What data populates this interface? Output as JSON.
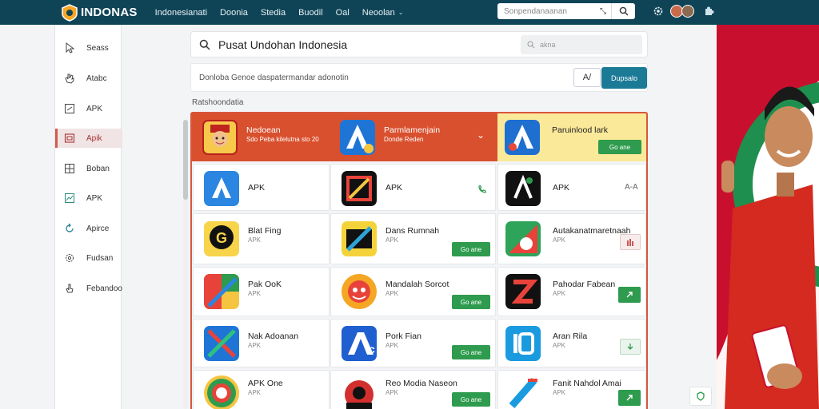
{
  "brand": {
    "name": "INDONAS"
  },
  "topnav": {
    "items": [
      "Indonesianati",
      "Doonia",
      "Stedia",
      "Buodil",
      "Oal",
      "Neoolan"
    ]
  },
  "top_search": {
    "placeholder": "Sonpendanaanan",
    "filter_icon": "filter-icon",
    "button_icon": "search-icon"
  },
  "sidebar": {
    "items": [
      {
        "label": "Seass",
        "icon": "cursor-icon"
      },
      {
        "label": "Atabc",
        "icon": "hand-icon"
      },
      {
        "label": "APK",
        "icon": "apk-box-icon"
      },
      {
        "label": "Apik",
        "icon": "window-icon",
        "active": true
      },
      {
        "label": "Boban",
        "icon": "grid-icon"
      },
      {
        "label": "APK",
        "icon": "chart-icon"
      },
      {
        "label": "Apirce",
        "icon": "refresh-icon"
      },
      {
        "label": "Fudsan",
        "icon": "settings-icon"
      },
      {
        "label": "Febandoo",
        "icon": "pointer-icon"
      }
    ]
  },
  "main_search": {
    "query": "Pusat Undohan Indonesia",
    "filter_placeholder": "akna"
  },
  "description": {
    "text": "Donloba Genoe daspatermandar adonotin",
    "button_a": "A/",
    "button_b": "Dupsalo"
  },
  "section": {
    "title": "Ratshoondatia"
  },
  "cards": [
    {
      "name": "Nedoean",
      "sub": "Sdo Peba kilelutna sto 20",
      "featured": true
    },
    {
      "name": "Parmlamenjain",
      "sub": "Donde Reden",
      "featured": true
    },
    {
      "name": "Paruinlood lark",
      "sub": "",
      "button": "Go ane"
    },
    {
      "name": "APK",
      "sub": ""
    },
    {
      "name": "APK",
      "sub": ""
    },
    {
      "name": "APK",
      "sub": "",
      "badge": "A-A"
    },
    {
      "name": "Blat Fing",
      "sub": "APK"
    },
    {
      "name": "Dans Rumnah",
      "sub": "APK",
      "button": "Go ane"
    },
    {
      "name": "Autakanatmaretnaah",
      "sub": "APK"
    },
    {
      "name": "Pak OoK",
      "sub": "APK"
    },
    {
      "name": "Mandalah Sorcot",
      "sub": "APK",
      "button": "Go ane"
    },
    {
      "name": "Pahodar Fabean",
      "sub": "APK"
    },
    {
      "name": "Nak Adoanan",
      "sub": "APK"
    },
    {
      "name": "Pork Fian",
      "sub": "APK",
      "button": "Go ane"
    },
    {
      "name": "Aran Rila",
      "sub": "APK"
    },
    {
      "name": "APK One",
      "sub": "APK"
    },
    {
      "name": "Reo Modia Naseon",
      "sub": "APK",
      "button": "Go ane"
    },
    {
      "name": "Fanit Nahdol Amai",
      "sub": "APK"
    }
  ],
  "colors": {
    "topbar": "#0f4457",
    "accent_red": "#d9502e",
    "accent_green": "#2e9b4e",
    "accent_teal": "#1b7a96"
  }
}
